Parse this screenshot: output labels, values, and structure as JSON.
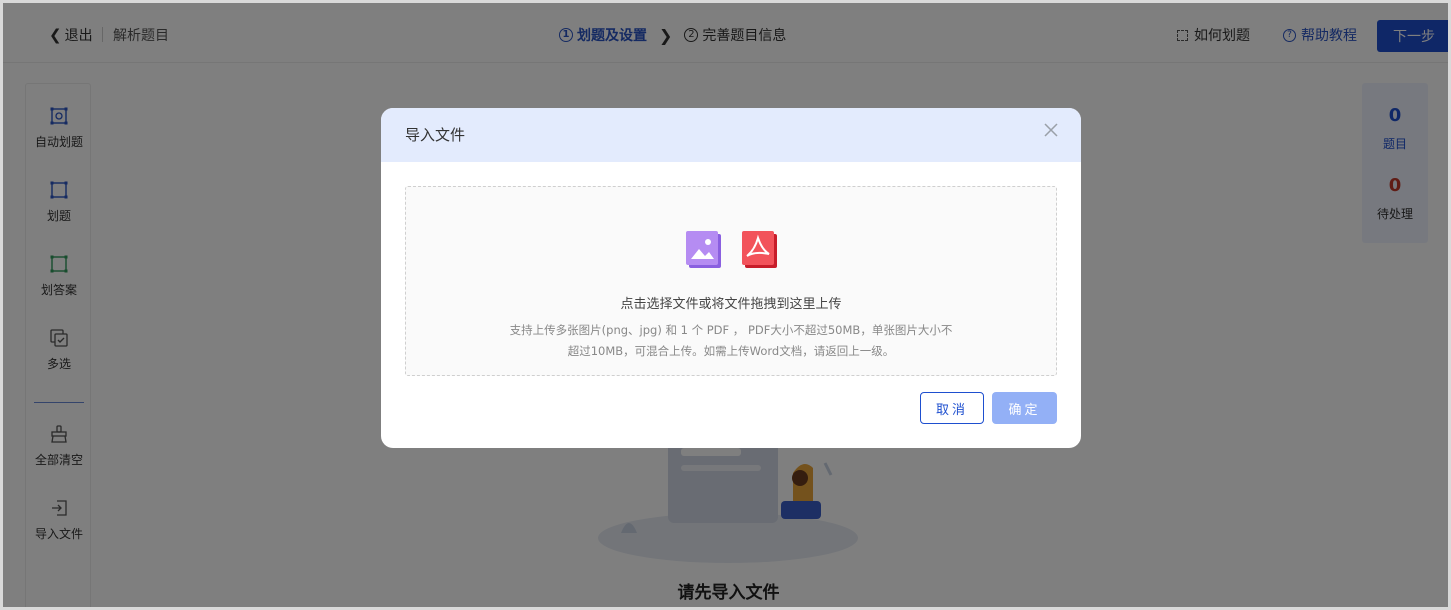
{
  "header": {
    "back_label": "退出",
    "crumb": "解析题目",
    "steps": [
      {
        "num": "1",
        "label": "划题及设置"
      },
      {
        "num": "2",
        "label": "完善题目信息"
      }
    ],
    "how_label": "如何划题",
    "help_label": "帮助教程",
    "next_label": "下一步"
  },
  "sidebar": {
    "items": [
      {
        "label": "自动划题",
        "icon": "auto-crop-icon"
      },
      {
        "label": "划题",
        "icon": "crop-icon"
      },
      {
        "label": "划答案",
        "icon": "crop-answer-icon"
      },
      {
        "label": "多选",
        "icon": "multi-select-icon"
      },
      {
        "label": "全部清空",
        "icon": "broom-icon"
      },
      {
        "label": "导入文件",
        "icon": "import-icon"
      }
    ]
  },
  "stats": {
    "questions_count": "0",
    "questions_label": "题目",
    "pending_count": "0",
    "pending_label": "待处理"
  },
  "main": {
    "empty_text": "请先导入文件"
  },
  "modal": {
    "title": "导入文件",
    "upload_main": "点击选择文件或将文件拖拽到这里上传",
    "upload_line1": "支持上传多张图片(png、jpg) 和 1 个 PDF ， PDF大小不超过50MB，单张图片大小不",
    "upload_line2": "超过10MB，可混合上传。如需上传Word文档，请返回上一级。",
    "cancel_label": "取消",
    "ok_label": "确定"
  },
  "colors": {
    "primary": "#1e4fcf",
    "accent_blue": "#2a55c5",
    "pending_red": "#c0392b",
    "modal_header_bg": "#e3ebfd",
    "ok_disabled": "#93b0f6"
  }
}
